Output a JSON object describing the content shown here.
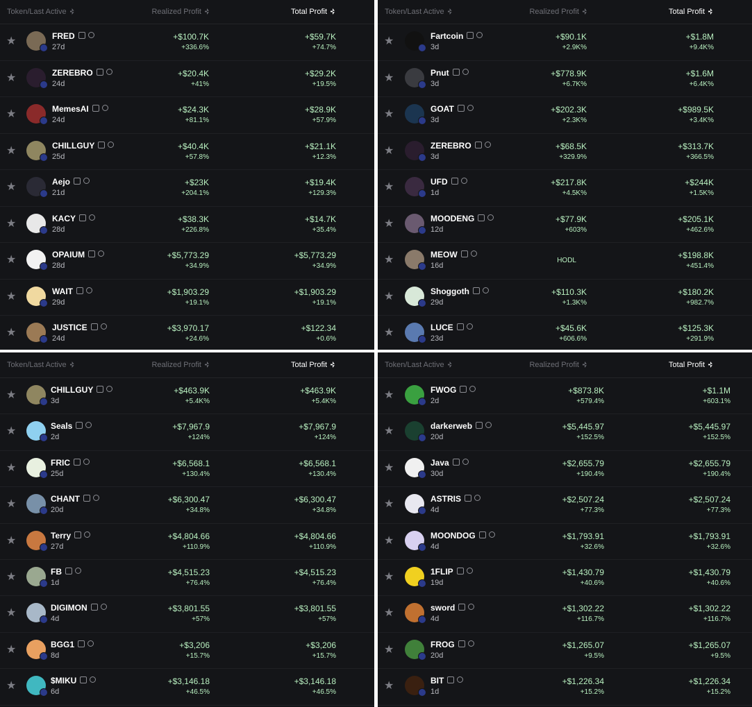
{
  "header": {
    "token": "Token/Last Active",
    "realized": "Realized Profit",
    "total": "Total Profit"
  },
  "panels": [
    {
      "rows": [
        {
          "name": "FRED",
          "age": "27d",
          "r": "+$100.7K",
          "rp": "+336.6%",
          "t": "+$59.7K",
          "tp": "+74.7%",
          "color": "#7a6a55"
        },
        {
          "name": "ZEREBRO",
          "age": "24d",
          "r": "+$20.4K",
          "rp": "+41%",
          "t": "+$29.2K",
          "tp": "+19.5%",
          "color": "#2a1d2e"
        },
        {
          "name": "MemesAI",
          "age": "24d",
          "r": "+$24.3K",
          "rp": "+81.1%",
          "t": "+$28.9K",
          "tp": "+57.9%",
          "color": "#8a2a2a"
        },
        {
          "name": "CHILLGUY",
          "age": "25d",
          "r": "+$40.4K",
          "rp": "+57.8%",
          "t": "+$21.1K",
          "tp": "+12.3%",
          "color": "#8f8660"
        },
        {
          "name": "Aejo",
          "age": "21d",
          "r": "+$23K",
          "rp": "+204.1%",
          "t": "+$19.4K",
          "tp": "+129.3%",
          "color": "#2a2a35"
        },
        {
          "name": "KACY",
          "age": "28d",
          "r": "+$38.3K",
          "rp": "+226.8%",
          "t": "+$14.7K",
          "tp": "+35.4%",
          "color": "#e8e8e8"
        },
        {
          "name": "OPAIUM",
          "age": "28d",
          "r": "+$5,773.29",
          "rp": "+34.9%",
          "t": "+$5,773.29",
          "tp": "+34.9%",
          "color": "#f2f2f2"
        },
        {
          "name": "WAIT",
          "age": "29d",
          "r": "+$1,903.29",
          "rp": "+19.1%",
          "t": "+$1,903.29",
          "tp": "+19.1%",
          "color": "#f0d9a0"
        },
        {
          "name": "JUSTICE",
          "age": "24d",
          "r": "+$3,970.17",
          "rp": "+24.6%",
          "t": "+$122.34",
          "tp": "+0.6%",
          "color": "#9b7a55"
        }
      ]
    },
    {
      "rows": [
        {
          "name": "Fartcoin",
          "age": "3d",
          "r": "+$90.1K",
          "rp": "+2.9K%",
          "t": "+$1.8M",
          "tp": "+9.4K%",
          "color": "#111111"
        },
        {
          "name": "Pnut",
          "age": "3d",
          "r": "+$778.9K",
          "rp": "+6.7K%",
          "t": "+$1.6M",
          "tp": "+6.4K%",
          "color": "#3a3b40"
        },
        {
          "name": "GOAT",
          "age": "3d",
          "r": "+$202.3K",
          "rp": "+2.3K%",
          "t": "+$989.5K",
          "tp": "+3.4K%",
          "color": "#1b3550"
        },
        {
          "name": "ZEREBRO",
          "age": "3d",
          "r": "+$68.5K",
          "rp": "+329.9%",
          "t": "+$313.7K",
          "tp": "+366.5%",
          "color": "#2a1d2e"
        },
        {
          "name": "UFD",
          "age": "1d",
          "r": "+$217.8K",
          "rp": "+4.5K%",
          "t": "+$244K",
          "tp": "+1.5K%",
          "color": "#3a2a40"
        },
        {
          "name": "MOODENG",
          "age": "12d",
          "r": "+$77.9K",
          "rp": "+603%",
          "t": "+$205.1K",
          "tp": "+462.6%",
          "color": "#6a5a70"
        },
        {
          "name": "MEOW",
          "age": "16d",
          "r": "HODL",
          "rp": "",
          "t": "+$198.8K",
          "tp": "+451.4%",
          "color": "#8a7a6a"
        },
        {
          "name": "Shoggoth",
          "age": "29d",
          "r": "+$110.3K",
          "rp": "+1.3K%",
          "t": "+$180.2K",
          "tp": "+982.7%",
          "color": "#d8e8d8"
        },
        {
          "name": "LUCE",
          "age": "23d",
          "r": "+$45.6K",
          "rp": "+606.6%",
          "t": "+$125.3K",
          "tp": "+291.9%",
          "color": "#5a7ab0"
        }
      ]
    },
    {
      "rows": [
        {
          "name": "CHILLGUY",
          "age": "3d",
          "r": "+$463.9K",
          "rp": "+5.4K%",
          "t": "+$463.9K",
          "tp": "+5.4K%",
          "color": "#8f8660"
        },
        {
          "name": "Seals",
          "age": "2d",
          "r": "+$7,967.9",
          "rp": "+124%",
          "t": "+$7,967.9",
          "tp": "+124%",
          "color": "#8fd0f0"
        },
        {
          "name": "FRIC",
          "age": "25d",
          "r": "+$6,568.1",
          "rp": "+130.4%",
          "t": "+$6,568.1",
          "tp": "+130.4%",
          "color": "#e8f0e0"
        },
        {
          "name": "CHANT",
          "age": "20d",
          "r": "+$6,300.47",
          "rp": "+34.8%",
          "t": "+$6,300.47",
          "tp": "+34.8%",
          "color": "#7890a8"
        },
        {
          "name": "Terry",
          "age": "27d",
          "r": "+$4,804.66",
          "rp": "+110.9%",
          "t": "+$4,804.66",
          "tp": "+110.9%",
          "color": "#c87840"
        },
        {
          "name": "FB",
          "age": "1d",
          "r": "+$4,515.23",
          "rp": "+76.4%",
          "t": "+$4,515.23",
          "tp": "+76.4%",
          "color": "#9aa890"
        },
        {
          "name": "DIGIMON",
          "age": "4d",
          "r": "+$3,801.55",
          "rp": "+57%",
          "t": "+$3,801.55",
          "tp": "+57%",
          "color": "#a8b8c8"
        },
        {
          "name": "BGG1",
          "age": "8d",
          "r": "+$3,206",
          "rp": "+15.7%",
          "t": "+$3,206",
          "tp": "+15.7%",
          "color": "#e8a060"
        },
        {
          "name": "$MIKU",
          "age": "6d",
          "r": "+$3,146.18",
          "rp": "+46.5%",
          "t": "+$3,146.18",
          "tp": "+46.5%",
          "color": "#40b8c0"
        }
      ]
    },
    {
      "rows": [
        {
          "name": "FWOG",
          "age": "2d",
          "r": "+$873.8K",
          "rp": "+579.4%",
          "t": "+$1.1M",
          "tp": "+603.1%",
          "color": "#3aa040"
        },
        {
          "name": "darkerweb",
          "age": "20d",
          "r": "+$5,445.97",
          "rp": "+152.5%",
          "t": "+$5,445.97",
          "tp": "+152.5%",
          "color": "#1a4030"
        },
        {
          "name": "Java",
          "age": "30d",
          "r": "+$2,655.79",
          "rp": "+190.4%",
          "t": "+$2,655.79",
          "tp": "+190.4%",
          "color": "#f0f0f0"
        },
        {
          "name": "ASTRIS",
          "age": "4d",
          "r": "+$2,507.24",
          "rp": "+77.3%",
          "t": "+$2,507.24",
          "tp": "+77.3%",
          "color": "#e8e8f0"
        },
        {
          "name": "MOONDOG",
          "age": "4d",
          "r": "+$1,793.91",
          "rp": "+32.6%",
          "t": "+$1,793.91",
          "tp": "+32.6%",
          "color": "#d8d0f0"
        },
        {
          "name": "1FLIP",
          "age": "19d",
          "r": "+$1,430.79",
          "rp": "+40.6%",
          "t": "+$1,430.79",
          "tp": "+40.6%",
          "color": "#f0d020"
        },
        {
          "name": "sword",
          "age": "4d",
          "r": "+$1,302.22",
          "rp": "+116.7%",
          "t": "+$1,302.22",
          "tp": "+116.7%",
          "color": "#c07030"
        },
        {
          "name": "FROG",
          "age": "20d",
          "r": "+$1,265.07",
          "rp": "+9.5%",
          "t": "+$1,265.07",
          "tp": "+9.5%",
          "color": "#40803a"
        },
        {
          "name": "BIT",
          "age": "1d",
          "r": "+$1,226.34",
          "rp": "+15.2%",
          "t": "+$1,226.34",
          "tp": "+15.2%",
          "color": "#3a2010"
        }
      ]
    }
  ]
}
